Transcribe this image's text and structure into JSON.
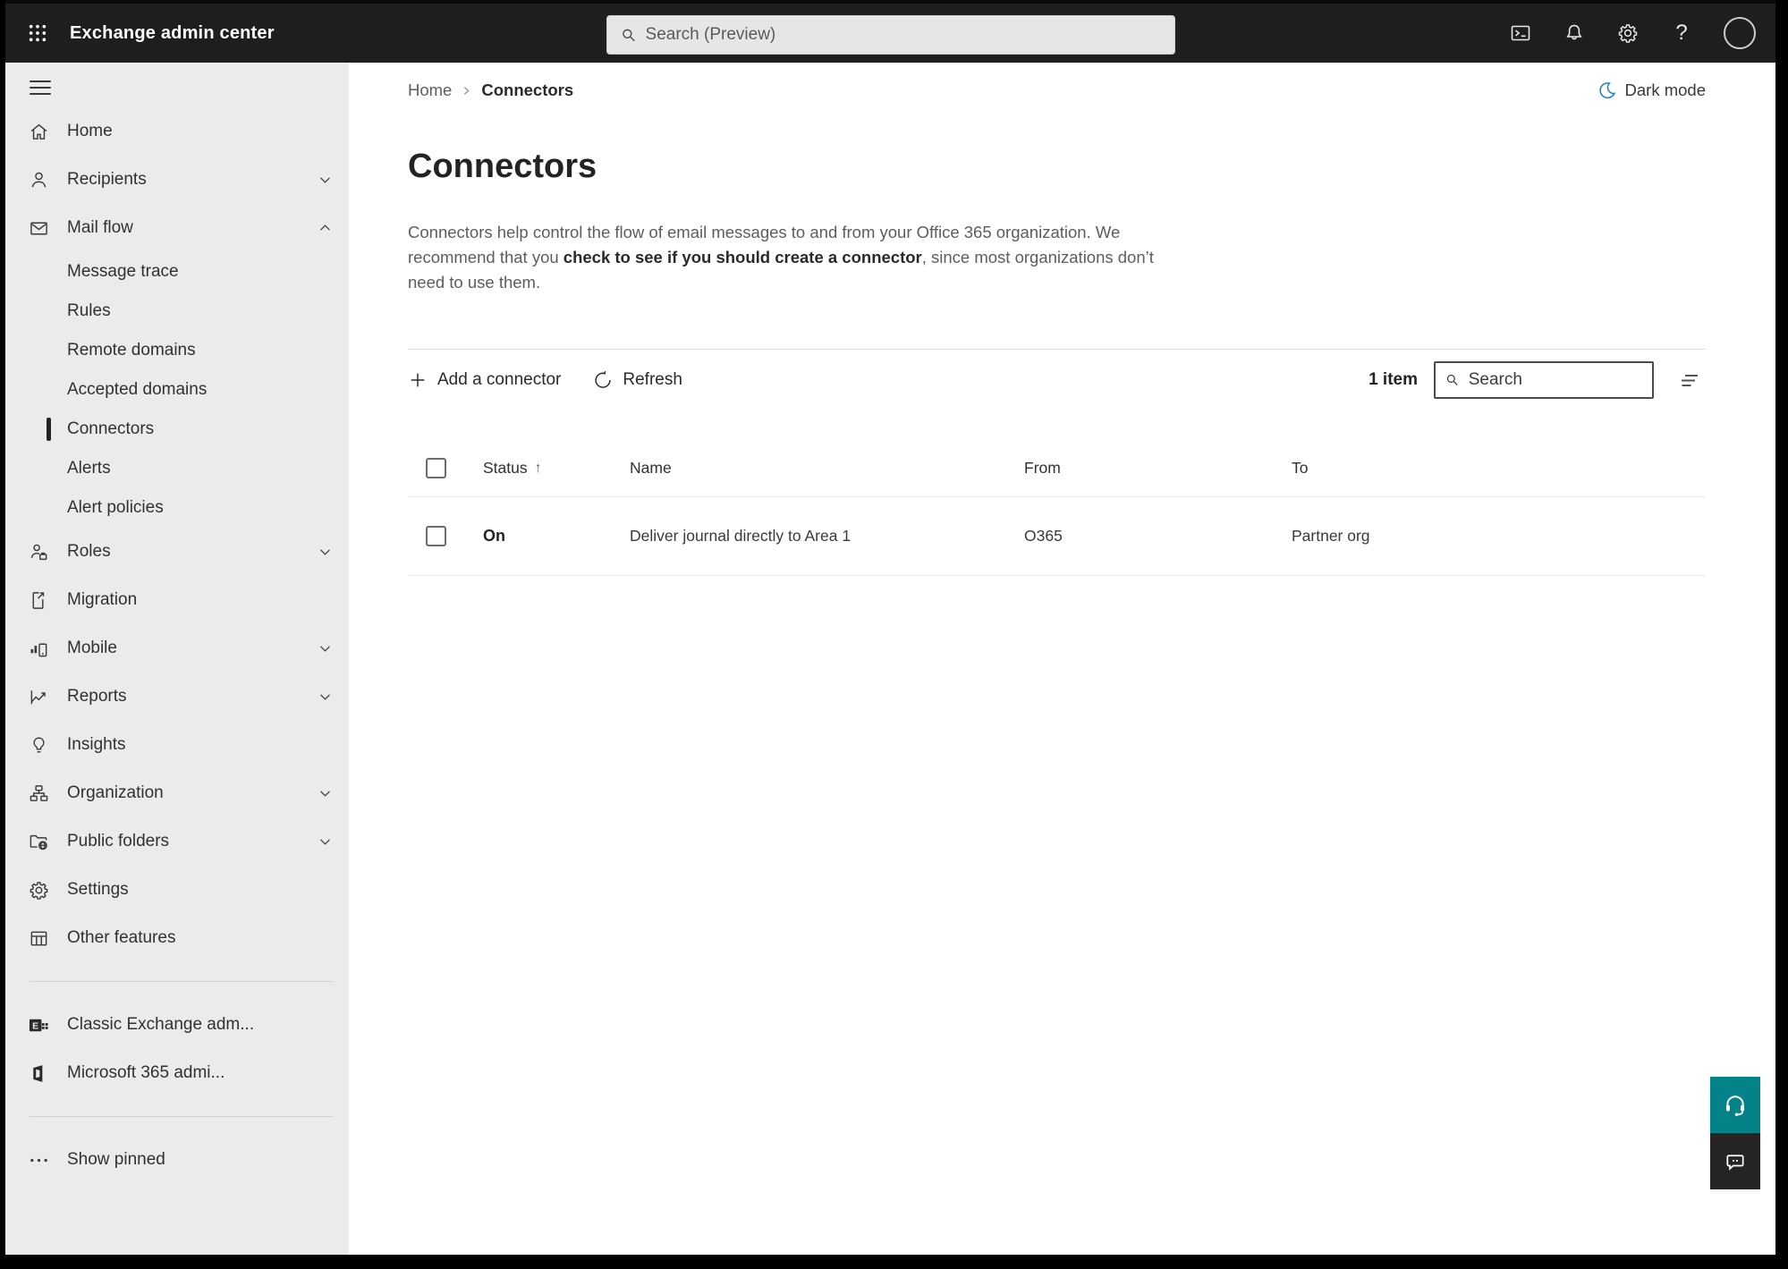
{
  "colors": {
    "topbar_bg": "#1e1e1d",
    "sidebar_bg": "#ebebeb",
    "accent_teal": "#038387",
    "feedback_dark": "#252423",
    "moon_blue": "#1a7fd4",
    "selected_indicator": "#242322"
  },
  "topbar": {
    "app_title": "Exchange admin center",
    "search_placeholder": "Search (Preview)"
  },
  "sidebar": {
    "home": "Home",
    "recipients": "Recipients",
    "mail_flow": "Mail flow",
    "mail_flow_children": {
      "message_trace": "Message trace",
      "rules": "Rules",
      "remote_domains": "Remote domains",
      "accepted_domains": "Accepted domains",
      "connectors": "Connectors",
      "alerts": "Alerts",
      "alert_policies": "Alert policies"
    },
    "roles": "Roles",
    "migration": "Migration",
    "mobile": "Mobile",
    "reports": "Reports",
    "insights": "Insights",
    "organization": "Organization",
    "public_folders": "Public folders",
    "settings": "Settings",
    "other_features": "Other features",
    "classic_exchange": "Classic Exchange adm...",
    "m365_admin": "Microsoft 365 admi...",
    "show_pinned": "Show pinned"
  },
  "breadcrumb": {
    "home": "Home",
    "current": "Connectors"
  },
  "theme_toggle": {
    "label": "Dark mode"
  },
  "page": {
    "title": "Connectors",
    "desc_part1": "Connectors help control the flow of email messages to and from your Office 365 organization. We recommend that you ",
    "desc_emphasis": "check to see if you should create a connector",
    "desc_part2": ", since most organizations don’t need to use them."
  },
  "toolbar": {
    "add_connector_label": "Add a connector",
    "refresh_label": "Refresh",
    "item_count": "1 item",
    "search_placeholder": "Search"
  },
  "table": {
    "headers": {
      "status": "Status",
      "name": "Name",
      "from": "From",
      "to": "To"
    },
    "sort_arrow": "↑",
    "rows": [
      {
        "status": "On",
        "name": "Deliver journal directly to Area 1",
        "from": "O365",
        "to": "Partner org"
      }
    ]
  }
}
